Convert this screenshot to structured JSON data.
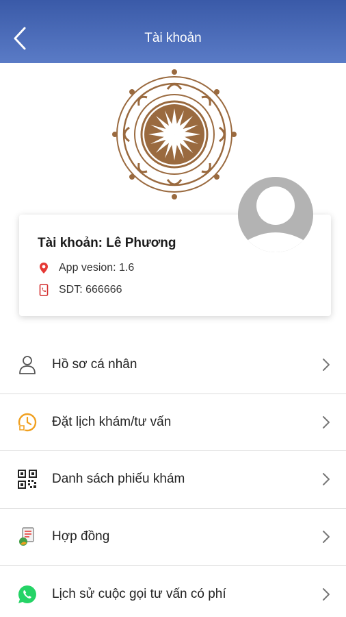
{
  "header": {
    "title": "Tài khoản",
    "back_icon": "chevron-left-icon"
  },
  "colors": {
    "header_gradient_top": "#3a5aa8",
    "header_gradient_bottom": "#5a7bc6",
    "logo_brown": "#9a6a3f",
    "location_red": "#e53935",
    "phone_red": "#d32f2f",
    "clock_orange": "#f0a020",
    "whatsapp_green": "#25d366"
  },
  "account": {
    "title": "Tài khoản: Lê Phương",
    "version_text": "App vesion: 1.6",
    "phone_text": "SDT: 666666",
    "version_icon": "location-pin-icon",
    "phone_icon": "phone-icon"
  },
  "avatar_icon": "user-avatar-icon",
  "menu": {
    "items": [
      {
        "label": "Hồ sơ cá nhân",
        "icon": "person-icon"
      },
      {
        "label": "Đặt lịch khám/tư vấn",
        "icon": "clock-calendar-icon"
      },
      {
        "label": "Danh sách phiếu khám",
        "icon": "qr-code-icon"
      },
      {
        "label": "Hợp đồng",
        "icon": "contract-document-icon"
      },
      {
        "label": "Lịch sử cuộc gọi tư vấn có phí",
        "icon": "whatsapp-icon"
      }
    ]
  }
}
